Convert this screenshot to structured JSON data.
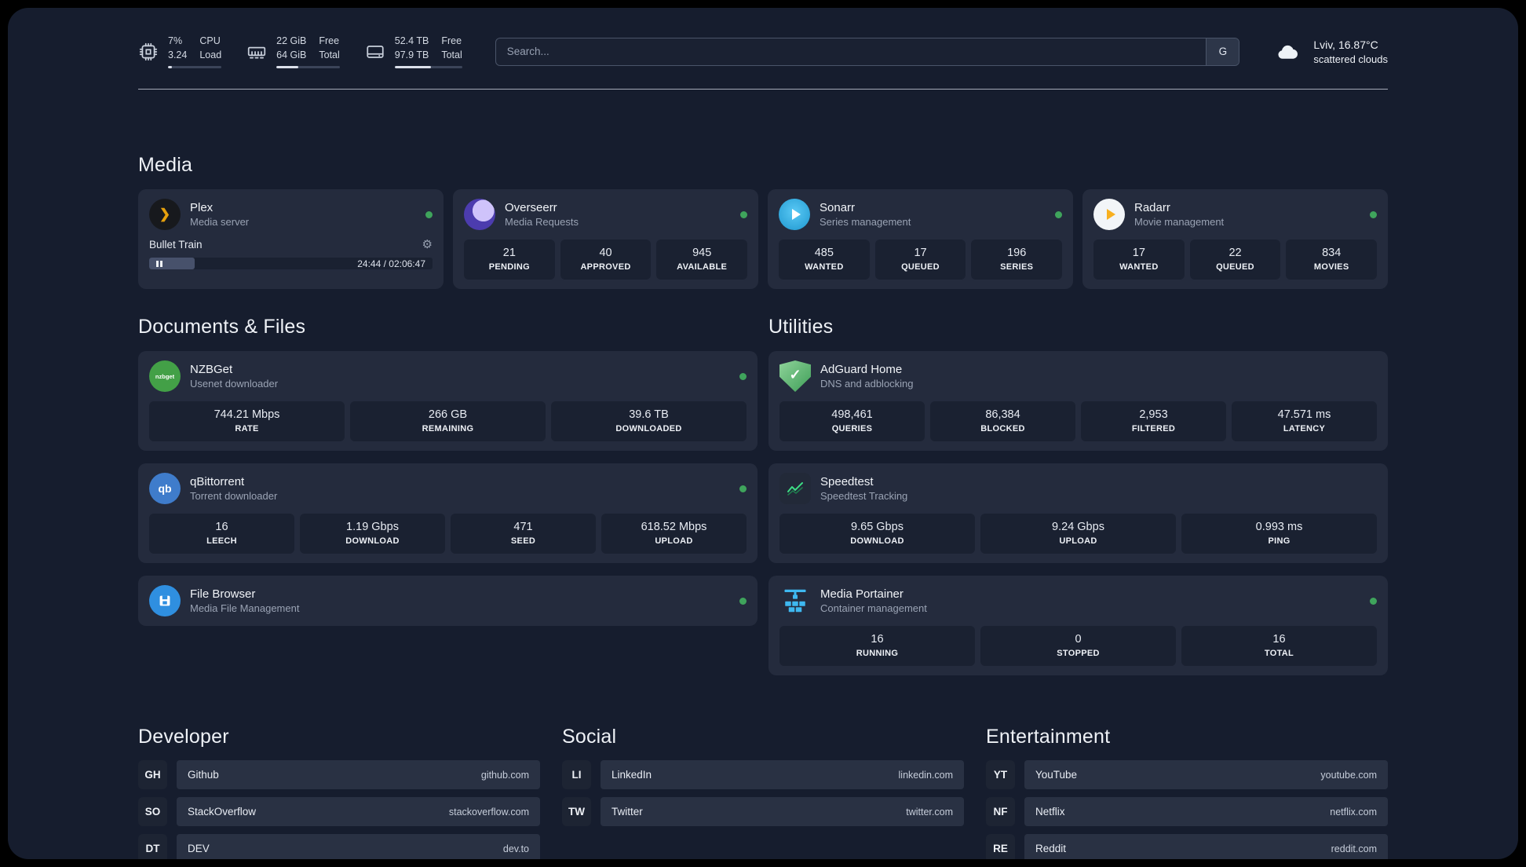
{
  "colors": {
    "background": "#161d2e",
    "card": "#242b3d",
    "stat_box": "#1a2131",
    "status_online": "#3fa45c",
    "plex_gold": "#e5a00d",
    "accent_blue": "#2f8fe0"
  },
  "header": {
    "cpu": {
      "percent": "7%",
      "load": "3.24",
      "label_top": "CPU",
      "label_bottom": "Load",
      "bar_percent": 7
    },
    "memory": {
      "free": "22 GiB",
      "total": "64 GiB",
      "label_top": "Free",
      "label_bottom": "Total",
      "bar_percent": 34
    },
    "storage": {
      "free": "52.4 TB",
      "total": "97.9 TB",
      "label_top": "Free",
      "label_bottom": "Total",
      "bar_percent": 54
    },
    "search": {
      "placeholder": "Search...",
      "button": "G"
    },
    "weather": {
      "location": "Lviv, 16.87°C",
      "condition": "scattered clouds"
    }
  },
  "media": {
    "title": "Media",
    "plex": {
      "name": "Plex",
      "subtitle": "Media server",
      "now_playing": "Bullet Train",
      "time": "24:44 / 02:06:47",
      "progress_percent": 16
    },
    "overseerr": {
      "name": "Overseerr",
      "subtitle": "Media Requests",
      "stats": [
        {
          "value": "21",
          "label": "PENDING"
        },
        {
          "value": "40",
          "label": "APPROVED"
        },
        {
          "value": "945",
          "label": "AVAILABLE"
        }
      ]
    },
    "sonarr": {
      "name": "Sonarr",
      "subtitle": "Series management",
      "stats": [
        {
          "value": "485",
          "label": "WANTED"
        },
        {
          "value": "17",
          "label": "QUEUED"
        },
        {
          "value": "196",
          "label": "SERIES"
        }
      ]
    },
    "radarr": {
      "name": "Radarr",
      "subtitle": "Movie management",
      "stats": [
        {
          "value": "17",
          "label": "WANTED"
        },
        {
          "value": "22",
          "label": "QUEUED"
        },
        {
          "value": "834",
          "label": "MOVIES"
        }
      ]
    }
  },
  "files": {
    "title": "Documents & Files",
    "nzbget": {
      "name": "NZBGet",
      "subtitle": "Usenet downloader",
      "icon_text": "nzbget",
      "stats": [
        {
          "value": "744.21 Mbps",
          "label": "RATE"
        },
        {
          "value": "266 GB",
          "label": "REMAINING"
        },
        {
          "value": "39.6 TB",
          "label": "DOWNLOADED"
        }
      ]
    },
    "qbittorrent": {
      "name": "qBittorrent",
      "subtitle": "Torrent downloader",
      "icon_text": "qb",
      "stats": [
        {
          "value": "16",
          "label": "LEECH"
        },
        {
          "value": "1.19 Gbps",
          "label": "DOWNLOAD"
        },
        {
          "value": "471",
          "label": "SEED"
        },
        {
          "value": "618.52 Mbps",
          "label": "UPLOAD"
        }
      ]
    },
    "filebrowser": {
      "name": "File Browser",
      "subtitle": "Media File Management"
    }
  },
  "utilities": {
    "title": "Utilities",
    "adguard": {
      "name": "AdGuard Home",
      "subtitle": "DNS and adblocking",
      "stats": [
        {
          "value": "498,461",
          "label": "QUERIES"
        },
        {
          "value": "86,384",
          "label": "BLOCKED"
        },
        {
          "value": "2,953",
          "label": "FILTERED"
        },
        {
          "value": "47.571 ms",
          "label": "LATENCY"
        }
      ]
    },
    "speedtest": {
      "name": "Speedtest",
      "subtitle": "Speedtest Tracking",
      "stats": [
        {
          "value": "9.65 Gbps",
          "label": "DOWNLOAD"
        },
        {
          "value": "9.24 Gbps",
          "label": "UPLOAD"
        },
        {
          "value": "0.993 ms",
          "label": "PING"
        }
      ]
    },
    "portainer": {
      "name": "Media Portainer",
      "subtitle": "Container management",
      "stats": [
        {
          "value": "16",
          "label": "RUNNING"
        },
        {
          "value": "0",
          "label": "STOPPED"
        },
        {
          "value": "16",
          "label": "TOTAL"
        }
      ]
    }
  },
  "bookmarks": {
    "developer": {
      "title": "Developer",
      "items": [
        {
          "abbr": "GH",
          "name": "Github",
          "url": "github.com"
        },
        {
          "abbr": "SO",
          "name": "StackOverflow",
          "url": "stackoverflow.com"
        },
        {
          "abbr": "DT",
          "name": "DEV",
          "url": "dev.to"
        }
      ]
    },
    "social": {
      "title": "Social",
      "items": [
        {
          "abbr": "LI",
          "name": "LinkedIn",
          "url": "linkedin.com"
        },
        {
          "abbr": "TW",
          "name": "Twitter",
          "url": "twitter.com"
        }
      ]
    },
    "entertainment": {
      "title": "Entertainment",
      "items": [
        {
          "abbr": "YT",
          "name": "YouTube",
          "url": "youtube.com"
        },
        {
          "abbr": "NF",
          "name": "Netflix",
          "url": "netflix.com"
        },
        {
          "abbr": "RE",
          "name": "Reddit",
          "url": "reddit.com"
        }
      ]
    }
  }
}
